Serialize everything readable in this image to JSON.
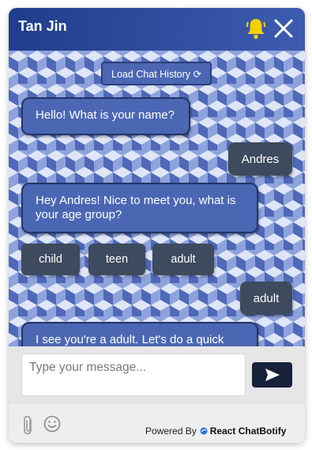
{
  "header": {
    "title": "Tan Jin",
    "bell_icon": "bell-icon",
    "close_icon": "close-icon"
  },
  "chat": {
    "load_history_label": "Load Chat History ⟳",
    "messages": [
      {
        "sender": "bot",
        "text": "Hello! What is your name?"
      },
      {
        "sender": "user",
        "text": "Andres"
      },
      {
        "sender": "bot",
        "text": "Hey Andres! Nice to meet you, what is your age group?"
      },
      {
        "sender": "user",
        "text": "adult"
      },
      {
        "sender": "bot",
        "text": "I see you're a adult. Let's do a quick"
      }
    ],
    "options": [
      "child",
      "teen",
      "adult"
    ]
  },
  "input": {
    "placeholder": "Type your message...",
    "value": "",
    "send_icon": "send-icon"
  },
  "footer": {
    "powered_by": "Powered By",
    "brand": "React ChatBotify",
    "attach_icon": "paperclip-icon",
    "emoji_icon": "emoji-icon"
  },
  "colors": {
    "header_start": "#1f3d8a",
    "header_end": "#3d5cb0",
    "bot_bubble": "#4b67b3",
    "user_bubble": "#3e4a5e",
    "send_button": "#16213a",
    "bell": "#f5d000"
  }
}
